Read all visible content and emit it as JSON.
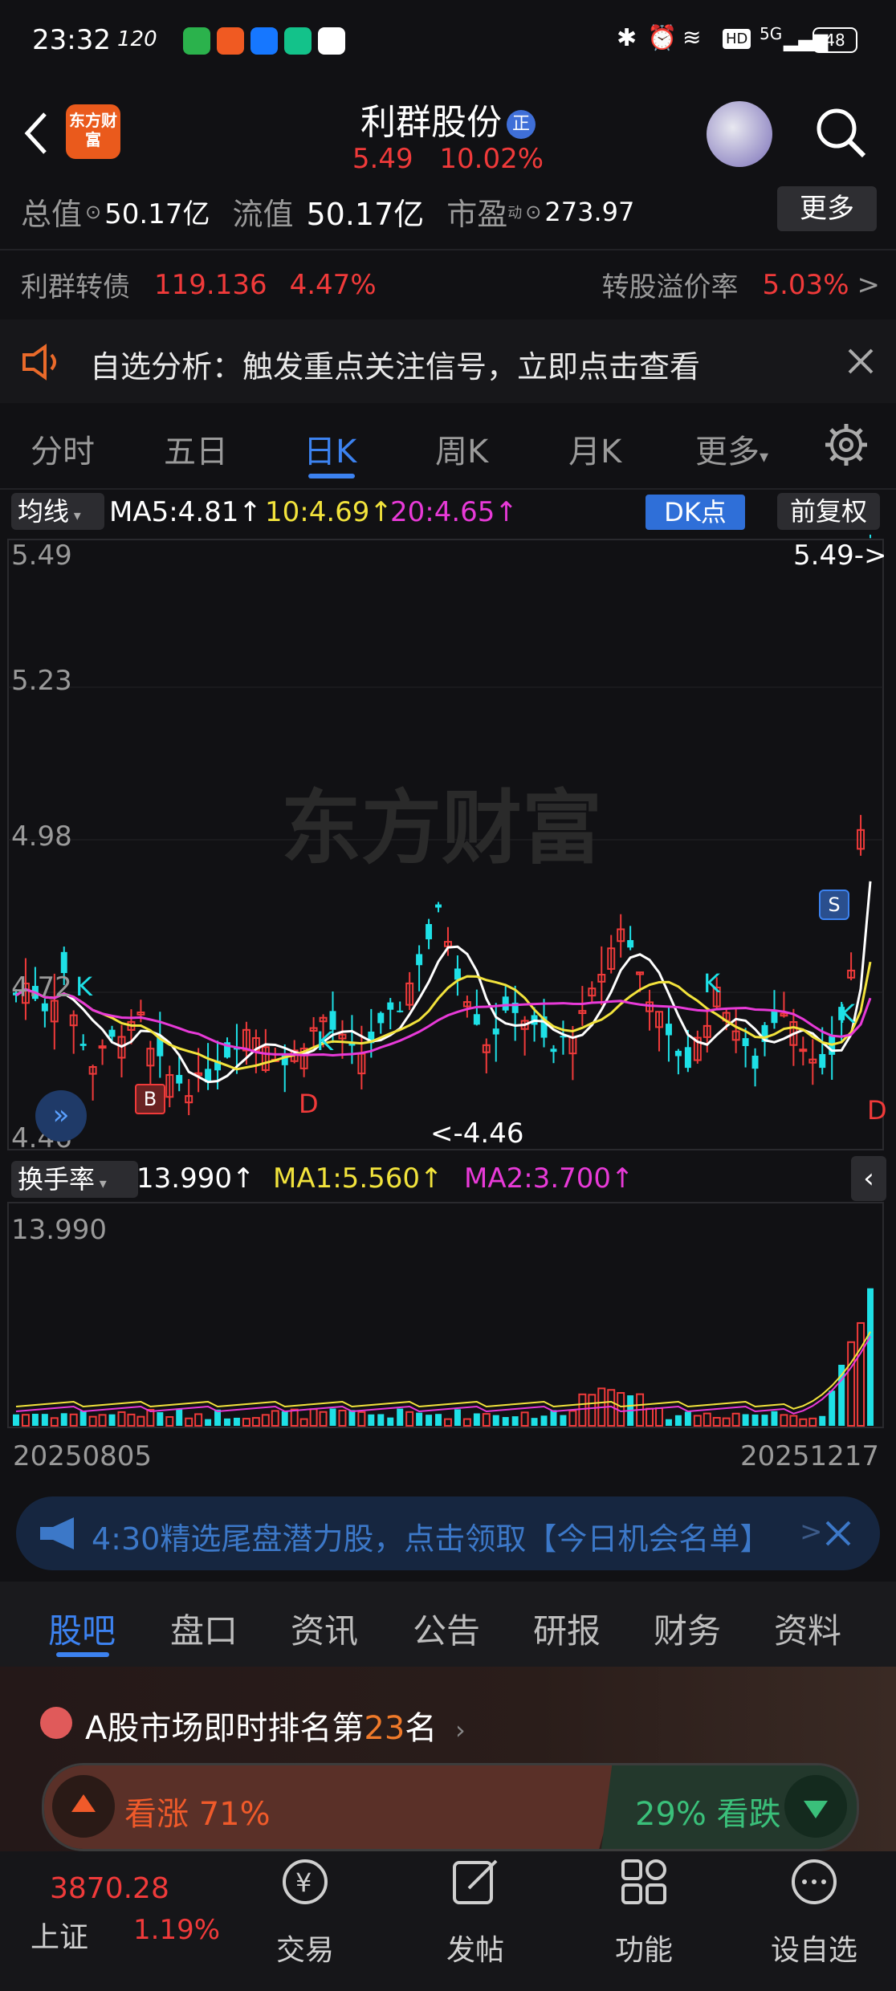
{
  "status_bar": {
    "time": "23:32",
    "refresh": "120",
    "network": "5G",
    "battery": "48"
  },
  "header": {
    "logo_text": "东方财富",
    "stock_name": "利群股份",
    "badge": "正",
    "price": "5.49",
    "change_pct": "10.02%"
  },
  "stats": {
    "total_value_label": "总值",
    "total_value": "50.17亿",
    "float_value_label": "流值",
    "float_value": "50.17亿",
    "pe_label": "市盈",
    "pe_sup": "动",
    "pe_value": "273.97",
    "more_label": "更多"
  },
  "convertible": {
    "name": "利群转债",
    "price": "119.136",
    "change": "4.47%",
    "premium_label": "转股溢价率",
    "premium_value": "5.03%"
  },
  "notice": {
    "text": "自选分析：触发重点关注信号，立即点击查看"
  },
  "chart_tabs": [
    "分时",
    "五日",
    "日K",
    "周K",
    "月K",
    "更多"
  ],
  "chart_tab_active": 2,
  "kline": {
    "ma_selector": "均线",
    "ma5": "MA5:4.81",
    "ma10": "10:4.69",
    "ma20": "20:4.65",
    "dk_button": "DK点",
    "adjust_button": "前复权",
    "y_labels": [
      "5.49",
      "5.23",
      "4.98",
      "4.72",
      "4.46"
    ],
    "last_marker": "5.49->",
    "low_marker": "<-4.46",
    "watermark": "东方财富"
  },
  "turnover": {
    "selector": "换手率",
    "value": "13.990",
    "ma1": "MA1:5.560",
    "ma2": "MA2:3.700",
    "y_max": "13.990",
    "date_start": "20250805",
    "date_end": "20251217"
  },
  "banner": {
    "text": "4:30精选尾盘潜力股，点击领取【今日机会名单】"
  },
  "bottom_tabs": [
    "股吧",
    "盘口",
    "资讯",
    "公告",
    "研报",
    "财务",
    "资料"
  ],
  "bottom_tab_active": 0,
  "ranking": {
    "prefix": "A股市场即时排名第",
    "rank": "23",
    "suffix": "名",
    "bull_label": "看涨 71%",
    "bear_label": "29% 看跌",
    "bull_pct": 71
  },
  "index": {
    "value": "3870.28",
    "name": "上证",
    "change": "1.19%"
  },
  "bottom_nav": [
    "交易",
    "发帖",
    "功能",
    "设自选"
  ],
  "colors": {
    "up": "#f03a3a",
    "down": "#1ee0e6",
    "accent": "#3c82f0",
    "ma5": "#ffffff",
    "ma10": "#f2e33c",
    "ma20": "#e83ad8"
  }
}
